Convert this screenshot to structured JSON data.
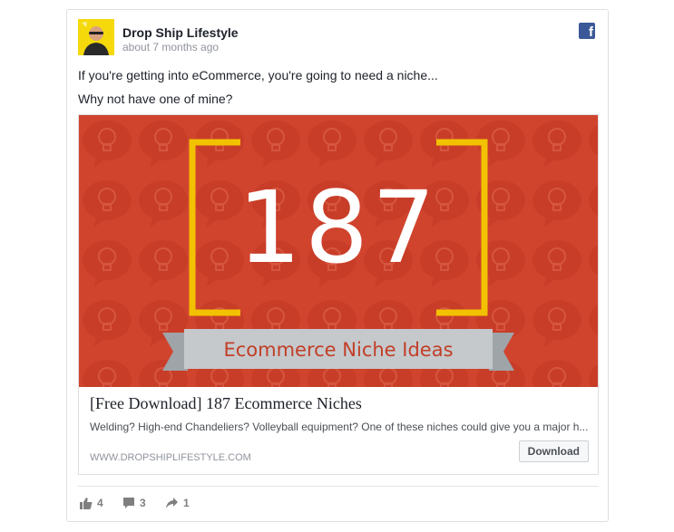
{
  "post": {
    "page_name": "Drop Ship Lifestyle",
    "timestamp": "about 7 months ago",
    "line1": "If you're getting into eCommerce, you're going to need a niche...",
    "line2": "Why not have one of mine?",
    "platform_icon": "facebook-icon"
  },
  "link": {
    "image": {
      "number": "187",
      "ribbon_text": "Ecommerce Niche Ideas",
      "background_color": "#d0442e",
      "bracket_color": "#f2c200",
      "ribbon_color": "#c5c9cc"
    },
    "title": "[Free Download] 187 Ecommerce Niches",
    "description": "Welding? High-end Chandeliers? Volleyball equipment? One of these niches could give you a major h...",
    "domain": "WWW.DROPSHIPLIFESTYLE.COM",
    "button_label": "Download"
  },
  "stats": {
    "likes": "4",
    "comments": "3",
    "shares": "1"
  }
}
